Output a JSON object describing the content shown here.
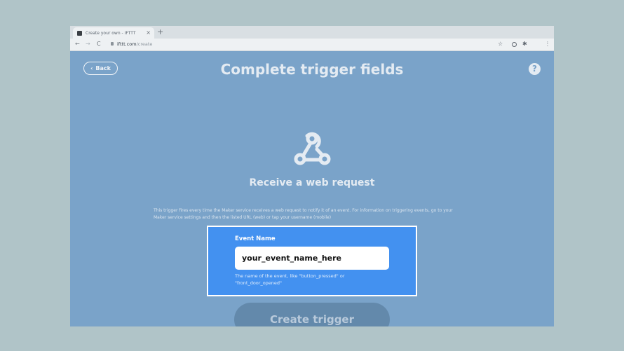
{
  "browser": {
    "tab_title": "Create your own - IFTTT",
    "tab_close": "×",
    "new_tab": "+",
    "url_host": "ifttt.com",
    "url_path": "/create",
    "back_icon": "←",
    "forward_icon": "→",
    "reload_icon": "C",
    "star_icon": "☆",
    "extension_icon": "✱",
    "menu_icon": "⋮"
  },
  "page": {
    "back_label": "Back",
    "back_chevron": "‹",
    "title": "Complete trigger fields",
    "help_label": "?",
    "service_icon": "webhook-icon",
    "service_title": "Receive a web request",
    "description": "This trigger fires every time the Maker service receives a web request to notify it of an event. For information on triggering events, go to your Maker service settings and then the listed URL (web) or tap your username (mobile)",
    "field": {
      "label": "Event Name",
      "value": "your_event_name_here",
      "help": "The name of the event, like \"button_pressed\" or \"front_door_opened\""
    },
    "submit_label": "Create trigger"
  },
  "colors": {
    "page_background": "#7aa3c9",
    "field_highlight": "#4391f0",
    "button_disabled": "#6389ab",
    "outer_background": "#b0c4c8"
  }
}
